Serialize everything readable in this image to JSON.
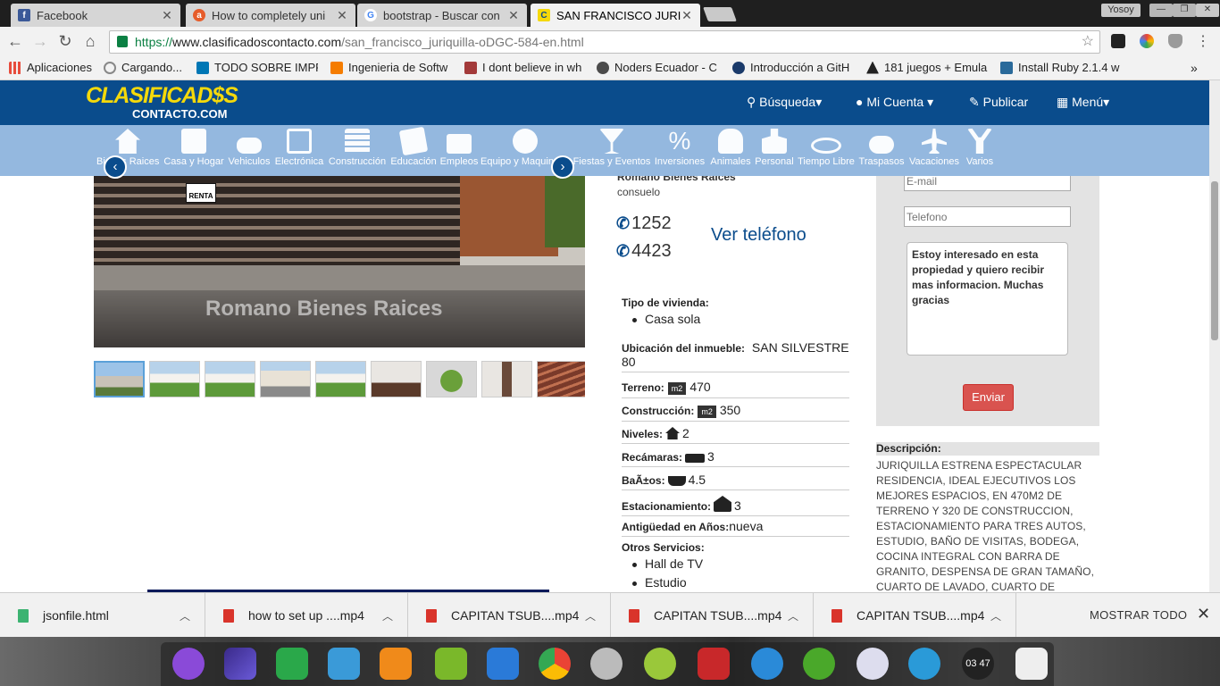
{
  "browser": {
    "tabs": [
      {
        "title": "Facebook",
        "icon": "facebook-icon",
        "color": "#3b5998",
        "active": false
      },
      {
        "title": "How to completely uni",
        "icon": "ask-icon",
        "color": "#e65c2a",
        "active": false
      },
      {
        "title": "bootstrap - Buscar con",
        "icon": "google-icon",
        "color": "#4285f4",
        "active": false
      },
      {
        "title": "SAN FRANCISCO JURIQ",
        "icon": "clasificados-icon",
        "color": "#f5d90a",
        "active": true
      }
    ],
    "profile_name": "Yosoy",
    "url": {
      "scheme": "https://",
      "domain": "www.clasificadoscontacto.com",
      "path": "/san_francisco_juriquilla-oDGC-584-en.html"
    },
    "bookmarks": [
      {
        "label": "Aplicaciones",
        "color": "#e74c3c"
      },
      {
        "label": "Cargando...",
        "color": "#888888"
      },
      {
        "label": "TODO SOBRE IMPR",
        "color": "#0077b5"
      },
      {
        "label": "Ingenieria de Softw",
        "color": "#f57c00"
      },
      {
        "label": "I dont believe in wh",
        "color": "#a33a3a"
      },
      {
        "label": "Noders Ecuador - C",
        "color": "#4b4b4b"
      },
      {
        "label": "Introducción a GitH",
        "color": "#1a3a6a"
      },
      {
        "label": "181 juegos + Emula",
        "color": "#222222"
      },
      {
        "label": "Install Ruby 2.1.4 w",
        "color": "#2a6a9a"
      }
    ],
    "bookmarks_more": "»"
  },
  "site": {
    "logo_line1": "CLASIFICAD$S",
    "logo_line2": "CONTACTO.COM",
    "nav": [
      {
        "label": "Búsqueda",
        "icon": "search-icon",
        "caret": "▾"
      },
      {
        "label": "Mi Cuenta",
        "icon": "user-icon",
        "caret": "▾"
      },
      {
        "label": "Publicar",
        "icon": "pin-icon",
        "caret": ""
      },
      {
        "label": "Menú",
        "icon": "grid-icon",
        "caret": "▾"
      }
    ],
    "categories": [
      "Bienes Raices",
      "Casa y Hogar",
      "Vehiculos",
      "Electrónica",
      "Construcción",
      "Educación",
      "Empleos",
      "Equipo y Maquinaria",
      "Fiestas y Eventos",
      "Inversiones",
      "Animales",
      "Personal",
      "Tiempo Libre",
      "Traspasos",
      "Vacaciones",
      "Varios"
    ],
    "carousel_prev": "‹",
    "carousel_next": "›"
  },
  "listing": {
    "watermark": "Romano Bienes Raices",
    "sign_text": "RENTA",
    "agent_name": "Romano Bienes Raices",
    "agent_sub": "consuelo",
    "phone1": "1252",
    "phone2": "4423",
    "ver_telefono": "Ver teléfono",
    "tipo_label": "Tipo de vivienda:",
    "tipo_value": "Casa sola",
    "ubicacion_label": "Ubicación del inmueble:",
    "ubicacion_value": "SAN SILVESTRE 80",
    "terreno_label": "Terreno:",
    "terreno_unit": "m2",
    "terreno_value": "470",
    "construccion_label": "Construcción:",
    "construccion_unit": "m2",
    "construccion_value": "350",
    "niveles_label": "Niveles:",
    "niveles_value": "2",
    "recamaras_label": "Recámaras:",
    "recamaras_value": "3",
    "banos_label": "BaÃ±os:",
    "banos_value": "4.5",
    "estacionamiento_label": "Estacionamiento:",
    "estacionamiento_value": "3",
    "antiguedad_label": "Antigüedad en Años:",
    "antiguedad_value": "nueva",
    "otros_label": "Otros Servicios:",
    "otros": [
      "Hall de TV",
      "Estudio"
    ]
  },
  "contact_form": {
    "email_placeholder": "E-mail",
    "telefono_placeholder": "Telefono",
    "message": "Estoy interesado en esta propiedad y quiero recibir mas informacion. Muchas gracias",
    "send_label": "Enviar"
  },
  "description": {
    "title": "Descripción:",
    "text": "JURIQUILLA ESTRENA ESPECTACULAR RESIDENCIA, IDEAL EJECUTIVOS LOS MEJORES ESPACIOS, EN 470M2 DE TERRENO Y 320 DE CONSTRUCCION, ESTACIONAMIENTO PARA TRES AUTOS, ESTUDIO, BAÑO DE VISITAS, BODEGA, COCINA INTEGRAL CON BARRA DE GRANITO, DESPENSA DE GRAN TAMAÑO, CUARTO DE LAVADO, CUARTO DE"
  },
  "downloads": {
    "items": [
      {
        "name": "jsonfile.html",
        "color": "#3cb371"
      },
      {
        "name": "how to set up ....mp4",
        "color": "#d9342b"
      },
      {
        "name": "CAPITAN TSUB....mp4",
        "color": "#d9342b"
      },
      {
        "name": "CAPITAN TSUB....mp4",
        "color": "#d9342b"
      },
      {
        "name": "CAPITAN TSUB....mp4",
        "color": "#d9342b"
      }
    ],
    "show_all": "MOSTRAR TODO",
    "close": "✕"
  },
  "dock": {
    "clock": "03 47"
  }
}
